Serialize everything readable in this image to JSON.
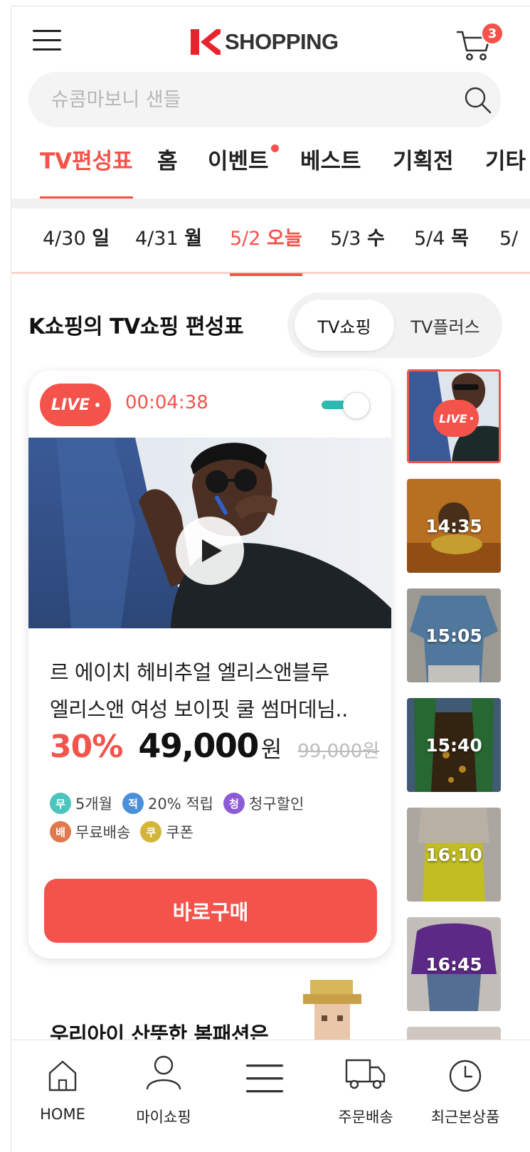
{
  "header": {
    "logo_text": "SHOPPING",
    "cart_count": "3"
  },
  "search": {
    "placeholder": "슈콤마보니 샌들"
  },
  "categories": [
    {
      "label": "TV편성표"
    },
    {
      "label": "홈"
    },
    {
      "label": "이벤트"
    },
    {
      "label": "베스트"
    },
    {
      "label": "기획전"
    },
    {
      "label": "기타"
    }
  ],
  "dates": [
    {
      "date": "4/30",
      "day": "일"
    },
    {
      "date": "4/31",
      "day": "월"
    },
    {
      "date": "5/2",
      "day": "오늘"
    },
    {
      "date": "5/3",
      "day": "수"
    },
    {
      "date": "5/4",
      "day": "목"
    },
    {
      "date": "5/",
      "day": ""
    }
  ],
  "section": {
    "title": "K쇼핑의 TV쇼핑 편성표",
    "toggle": [
      "TV쇼핑",
      "TV플러스"
    ]
  },
  "live_card": {
    "badge": "LIVE",
    "timer": "00:04:38",
    "product_name_line1": "르 에이치 헤비추얼 엘리스앤블루",
    "product_name_line2": "엘리스앤 여성 보이핏 쿨 썸머데님..",
    "discount": "30%",
    "price": "49,000",
    "currency": "원",
    "original_price": "99,000원",
    "benefits": [
      {
        "icon": "무",
        "text": "5개월",
        "color": "#4cc4be"
      },
      {
        "icon": "적",
        "text": "20% 적립",
        "color": "#4a90d9"
      },
      {
        "icon": "청",
        "text": "청구할인",
        "color": "#8e5bd6"
      },
      {
        "icon": "배",
        "text": "무료배송",
        "color": "#e07a4e"
      },
      {
        "icon": "쿠",
        "text": "쿠폰",
        "color": "#d4b43a"
      }
    ],
    "buy_label": "바로구매"
  },
  "schedule": [
    {
      "time": "",
      "live": "LIVE"
    },
    {
      "time": "14:35"
    },
    {
      "time": "15:05"
    },
    {
      "time": "15:40"
    },
    {
      "time": "16:10"
    },
    {
      "time": "16:45"
    }
  ],
  "next_section": {
    "title": "우리아이 산뜻한 봄패션은"
  },
  "bottom_nav": [
    {
      "label": "HOME"
    },
    {
      "label": "마이쇼핑"
    },
    {
      "label": ""
    },
    {
      "label": "주문배송"
    },
    {
      "label": "최근본상품"
    }
  ],
  "colors": {
    "brand": "#f4534b",
    "toggle_on": "#2fb8b0"
  }
}
